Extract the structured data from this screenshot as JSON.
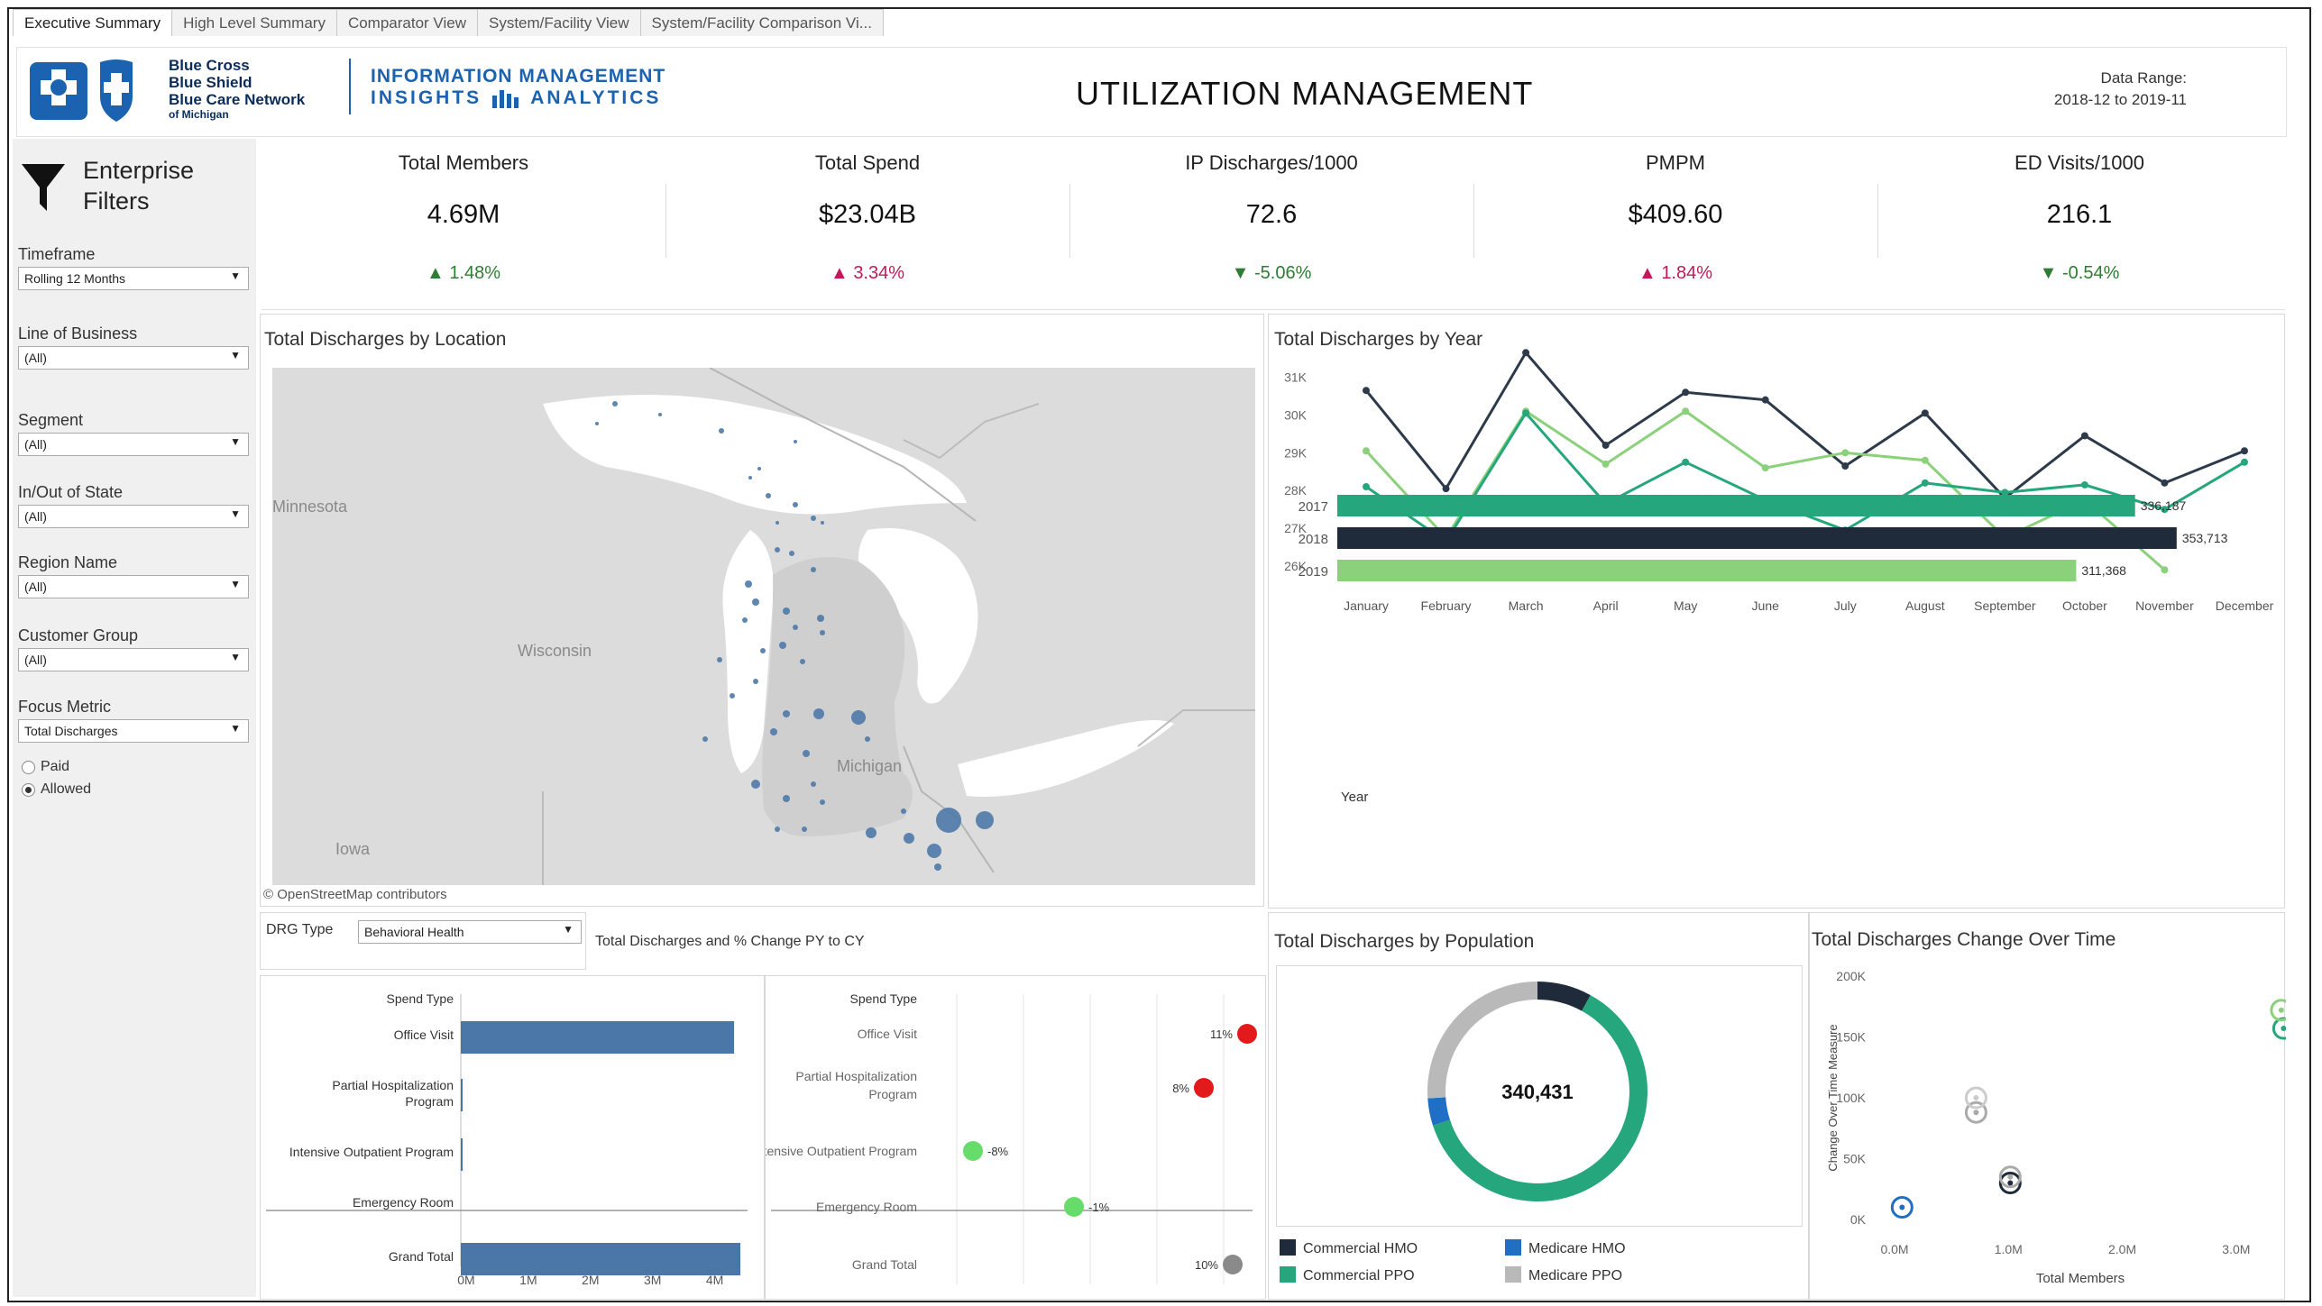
{
  "tabs": [
    "Executive Summary",
    "High Level Summary",
    "Comparator View",
    "System/Facility View",
    "System/Facility Comparison Vi..."
  ],
  "brand": {
    "line1": "Blue Cross",
    "line2": "Blue Shield",
    "line3": "Blue Care Network",
    "line4": "of Michigan",
    "im_line1": "INFORMATION MANAGEMENT",
    "im_line2": "INSIGHTS",
    "im_line3": "ANALYTICS"
  },
  "header": {
    "title": "UTILIZATION MANAGEMENT",
    "data_range_label": "Data Range:",
    "data_range_value": "2018-12 to 2019-11"
  },
  "filters": {
    "heading_line1": "Enterprise",
    "heading_line2": "Filters",
    "items": [
      {
        "label": "Timeframe",
        "value": "Rolling 12 Months"
      },
      {
        "label": "Line of Business",
        "value": "(All)"
      },
      {
        "label": "Segment",
        "value": "(All)"
      },
      {
        "label": "In/Out of State",
        "value": "(All)"
      },
      {
        "label": "Region Name",
        "value": "(All)"
      },
      {
        "label": "Customer Group",
        "value": "(All)"
      },
      {
        "label": "Focus Metric",
        "value": "Total Discharges"
      }
    ],
    "radio": [
      {
        "label": "Paid",
        "selected": false
      },
      {
        "label": "Allowed",
        "selected": true
      }
    ]
  },
  "kpis": [
    {
      "label": "Total Members",
      "value": "4.69M",
      "change": "1.48%",
      "dir": "up",
      "color": "#2e7d32"
    },
    {
      "label": "Total Spend",
      "value": "$23.04B",
      "change": "3.34%",
      "dir": "up",
      "color": "#c2185b"
    },
    {
      "label": "IP Discharges/1000",
      "value": "72.6",
      "change": "-5.06%",
      "dir": "down",
      "color": "#2e7d32"
    },
    {
      "label": "PMPM",
      "value": "$409.60",
      "change": "1.84%",
      "dir": "up",
      "color": "#c2185b"
    },
    {
      "label": "ED Visits/1000",
      "value": "216.1",
      "change": "-0.54%",
      "dir": "down",
      "color": "#2e7d32"
    }
  ],
  "map": {
    "title": "Total Discharges by Location",
    "labels": [
      "Minnesota",
      "Wisconsin",
      "Michigan",
      "Iowa"
    ],
    "attribution": "© OpenStreetMap contributors",
    "color": "#4e79a7"
  },
  "drg": {
    "label": "DRG Type",
    "value": "Behavioral Health",
    "subtitle": "Total Discharges and % Change PY to CY"
  },
  "chart_data": [
    {
      "type": "line",
      "title": "Total Discharges by Year",
      "categories": [
        "January",
        "February",
        "March",
        "April",
        "May",
        "June",
        "July",
        "August",
        "September",
        "October",
        "November",
        "December"
      ],
      "y_ticks": [
        "26K",
        "27K",
        "28K",
        "29K",
        "30K",
        "31K"
      ],
      "ylim": [
        25500,
        31800
      ],
      "series": [
        {
          "name": "2018",
          "color": "#2d3a4a",
          "values": [
            30650,
            28050,
            31650,
            29200,
            30600,
            30400,
            28650,
            30050,
            27800,
            29450,
            28200,
            29050
          ]
        },
        {
          "name": "2019",
          "color": "#8bd17b",
          "values": [
            29050,
            26750,
            30100,
            28700,
            30100,
            28600,
            29000,
            28800,
            26750,
            27750,
            25900,
            null
          ]
        },
        {
          "name": "2017",
          "color": "#26a67c",
          "values": [
            28100,
            26650,
            30050,
            27650,
            28750,
            27750,
            26950,
            28200,
            27950,
            28150,
            27500,
            28750
          ]
        }
      ]
    },
    {
      "type": "bar",
      "title": "Year",
      "categories": [
        "2017",
        "2018",
        "2019"
      ],
      "values": [
        336187,
        353713,
        311368
      ],
      "labels": [
        "336,187",
        "353,713",
        "311,368"
      ],
      "colors": [
        "#26a67c",
        "#1f2b3a",
        "#8bd17b"
      ]
    },
    {
      "type": "bar",
      "title": "Spend Type",
      "categories": [
        "Office Visit",
        "Partial Hospitalization Program",
        "Intensive Outpatient Program",
        "Emergency Room",
        "Grand Total"
      ],
      "values": [
        4400000,
        20000,
        10000,
        0,
        4500000
      ],
      "x_ticks": [
        "0M",
        "1M",
        "2M",
        "3M",
        "4M"
      ],
      "xlim": [
        0,
        4500000
      ],
      "color": "#4a76a8"
    },
    {
      "type": "scatter",
      "title": "Spend Type",
      "categories": [
        "Office Visit",
        "Partial Hospitalization Program",
        "Intensive Outpatient Program",
        "Emergency Room",
        "Grand Total"
      ],
      "values": [
        11,
        8,
        -8,
        -1,
        10
      ],
      "labels": [
        "11%",
        "8%",
        "-8%",
        "-1%",
        "10%"
      ],
      "colors": [
        "#e31a1c",
        "#e31a1c",
        "#66dd6a",
        "#66dd6a",
        "#8a8a8a"
      ]
    },
    {
      "type": "pie",
      "title": "Total Discharges by Population",
      "center_label": "340,431",
      "slices": [
        {
          "name": "Commercial HMO",
          "value": 8,
          "color": "#1f2b3a"
        },
        {
          "name": "Commercial PPO",
          "value": 62,
          "color": "#26a67c"
        },
        {
          "name": "Medicare HMO",
          "value": 4,
          "color": "#1f6fc5"
        },
        {
          "name": "Medicare PPO",
          "value": 26,
          "color": "#b9b9b9"
        }
      ]
    },
    {
      "type": "scatter",
      "title": "Total Discharges Change Over Time",
      "xlabel": "Total Members",
      "ylabel": "Change Over Time Measure",
      "x_ticks": [
        "0.0M",
        "1.0M",
        "2.0M",
        "3.0M"
      ],
      "y_ticks": [
        "0K",
        "50K",
        "100K",
        "150K",
        "200K"
      ],
      "xlim": [
        0,
        3500000
      ],
      "ylim": [
        0,
        200000
      ],
      "points": [
        {
          "x": 50000,
          "y": 10000,
          "color": "#1f6fc5"
        },
        {
          "x": 1000000,
          "y": 30000,
          "color": "#1f2b3a"
        },
        {
          "x": 1000000,
          "y": 35000,
          "color": "#aaaaaa"
        },
        {
          "x": 700000,
          "y": 88000,
          "color": "#aaaaaa"
        },
        {
          "x": 700000,
          "y": 100000,
          "color": "#cccccc"
        },
        {
          "x": 3400000,
          "y": 157000,
          "color": "#26a67c"
        },
        {
          "x": 3380000,
          "y": 172000,
          "color": "#8bd17b"
        }
      ]
    }
  ]
}
